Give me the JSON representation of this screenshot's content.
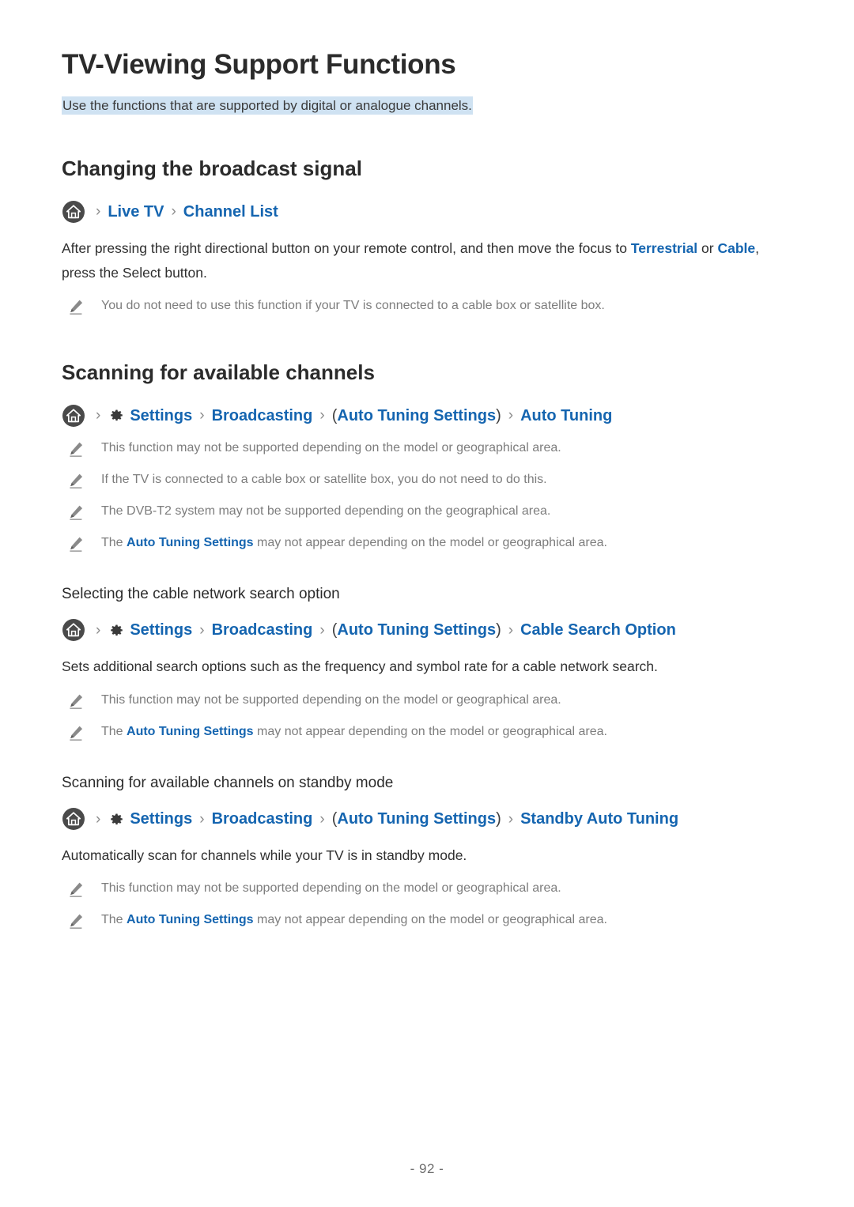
{
  "document": {
    "title": "TV-Viewing Support Functions",
    "subtitle": "Use the functions that are supported by digital or analogue channels.",
    "page_number": "- 92 -"
  },
  "colors": {
    "link_blue": "#1565b0",
    "highlight_blue": "#cfe2f2",
    "note_gray": "#7d7d7d",
    "heading_dark": "#2b2b2b",
    "home_icon_circle": "#4a4a4a"
  },
  "icons": {
    "home": "home-icon",
    "gear": "gear-icon",
    "note": "pencil-note-icon",
    "separator": "›"
  },
  "sections": [
    {
      "heading": "Changing the broadcast signal",
      "breadcrumb": {
        "home": "home-icon",
        "sep": "›",
        "items": [
          {
            "label": "Live TV",
            "type": "link"
          },
          {
            "label": "Channel List",
            "type": "link"
          }
        ]
      },
      "paragraph": {
        "prefix": "After pressing the right directional button on your remote control, and then move the focus to ",
        "link1": "Terrestrial",
        "mid": " or ",
        "link2": "Cable",
        "suffix": ", press the Select button."
      },
      "notes": [
        {
          "text": "You do not need to use this function if your TV is connected to a cable box or satellite box."
        }
      ]
    },
    {
      "heading": "Scanning for available channels",
      "breadcrumb": {
        "home": "home-icon",
        "gear": "gear-icon",
        "sep": "›",
        "items": [
          {
            "label": "Settings",
            "type": "link-gear"
          },
          {
            "label": "Broadcasting",
            "type": "link"
          },
          {
            "label": "Auto Tuning Settings",
            "type": "link-paren"
          },
          {
            "label": "Auto Tuning",
            "type": "link"
          }
        ]
      },
      "notes": [
        {
          "text": "This function may not be supported depending on the model or geographical area."
        },
        {
          "text": "If the TV is connected to a cable box or satellite box, you do not need to do this."
        },
        {
          "text": "The DVB-T2 system may not be supported depending on the geographical area."
        },
        {
          "prefix": "The ",
          "link": "Auto Tuning Settings",
          "suffix": " may not appear depending on the model or geographical area."
        }
      ],
      "subsections": [
        {
          "heading": "Selecting the cable network search option",
          "breadcrumb": {
            "home": "home-icon",
            "gear": "gear-icon",
            "sep": "›",
            "items": [
              {
                "label": "Settings",
                "type": "link-gear"
              },
              {
                "label": "Broadcasting",
                "type": "link"
              },
              {
                "label": "Auto Tuning Settings",
                "type": "link-paren"
              },
              {
                "label": "Cable Search Option",
                "type": "link"
              }
            ]
          },
          "paragraph": "Sets additional search options such as the frequency and symbol rate for a cable network search.",
          "notes": [
            {
              "text": "This function may not be supported depending on the model or geographical area."
            },
            {
              "prefix": "The ",
              "link": "Auto Tuning Settings",
              "suffix": " may not appear depending on the model or geographical area."
            }
          ]
        },
        {
          "heading": "Scanning for available channels on standby mode",
          "breadcrumb": {
            "home": "home-icon",
            "gear": "gear-icon",
            "sep": "›",
            "items": [
              {
                "label": "Settings",
                "type": "link-gear"
              },
              {
                "label": "Broadcasting",
                "type": "link"
              },
              {
                "label": "Auto Tuning Settings",
                "type": "link-paren"
              },
              {
                "label": "Standby Auto Tuning",
                "type": "link"
              }
            ]
          },
          "paragraph": "Automatically scan for channels while your TV is in standby mode.",
          "notes": [
            {
              "text": "This function may not be supported depending on the model or geographical area."
            },
            {
              "prefix": "The ",
              "link": "Auto Tuning Settings",
              "suffix": " may not appear depending on the model or geographical area."
            }
          ]
        }
      ]
    }
  ]
}
